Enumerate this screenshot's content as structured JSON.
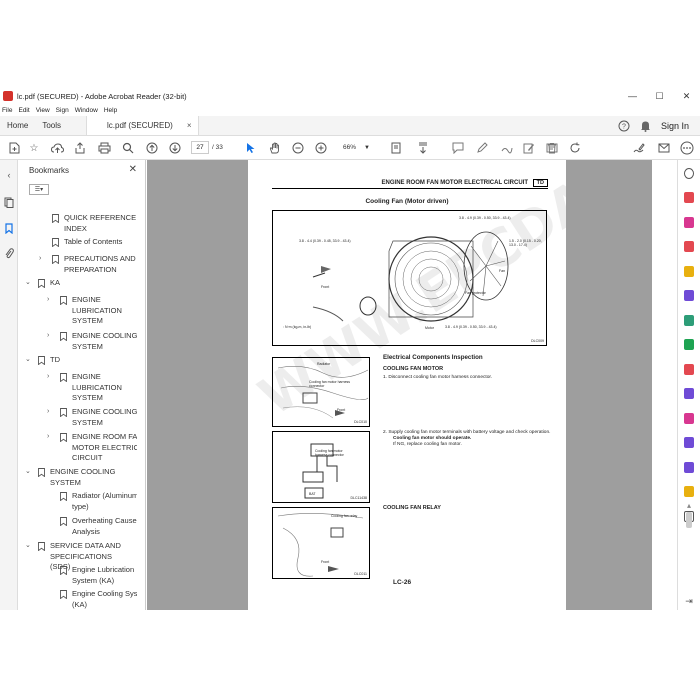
{
  "window": {
    "title": "lc.pdf (SECURED) - Adobe Acrobat Reader (32-bit)",
    "minimize": "—",
    "maximize": "☐",
    "close": "✕"
  },
  "menu": [
    "File",
    "Edit",
    "View",
    "Sign",
    "Window",
    "Help"
  ],
  "tabs": {
    "home": "Home",
    "tools": "Tools",
    "document": "lc.pdf (SECURED)",
    "close": "×",
    "signin": "Sign In"
  },
  "toolbar": {
    "page_current": "27",
    "page_total": "/ 33",
    "zoom": "66%"
  },
  "bookmarks": {
    "title": "Bookmarks",
    "close": "✕",
    "options": "☰▾",
    "items": [
      {
        "label": "QUICK REFERENCE INDEX",
        "chevron": ""
      },
      {
        "label": "Table of Contents",
        "chevron": ""
      },
      {
        "label": "PRECAUTIONS AND PREPARATION",
        "chevron": "›"
      },
      {
        "label": "KA",
        "chevron": "⌄"
      },
      {
        "label": "ENGINE LUBRICATION SYSTEM",
        "chevron": "›"
      },
      {
        "label": "ENGINE COOLING SYSTEM",
        "chevron": "›"
      },
      {
        "label": "TD",
        "chevron": "⌄"
      },
      {
        "label": "ENGINE LUBRICATION SYSTEM",
        "chevron": "›"
      },
      {
        "label": "ENGINE COOLING SYSTEM",
        "chevron": "›"
      },
      {
        "label": "ENGINE ROOM FAN MOTOR ELECTRICAL CIRCUIT",
        "chevron": "›"
      },
      {
        "label": "ENGINE COOLING SYSTEM",
        "chevron": "⌄"
      },
      {
        "label": "Radiator (Aluminum type)",
        "chevron": ""
      },
      {
        "label": "Overheating Cause Analysis",
        "chevron": ""
      },
      {
        "label": "SERVICE DATA AND SPECIFICATIONS (SDS)",
        "chevron": "⌄"
      },
      {
        "label": "Engine Lubrication System (KA)",
        "chevron": ""
      },
      {
        "label": "Engine Cooling System (KA)",
        "chevron": ""
      }
    ]
  },
  "document": {
    "header": "ENGINE ROOM FAN MOTOR ELECTRICAL CIRCUIT",
    "header_tag": "TD",
    "figure_title": "Cooling Fan (Motor driven)",
    "fig1_labels": {
      "torque_a": "3.8 - 4.4 (0.39 - 0.45, 33.9 - 43.4)",
      "torque_b": "3.8 - 4.9 (0.39 - 0.50, 33.9 - 43.4)",
      "torque_c": "1.5 - 2.0 (0.15 - 0.20, 13.0 - 17.4)",
      "torque_d": "3.8 - 4.9 (0.39 - 0.50, 33.9 - 43.4)",
      "fan": "Fan",
      "fan_protector": "Fan protector",
      "front": "Front",
      "motor": "Motor",
      "unit": ": N·m (kg-m, in-lb)",
      "code": "DLC009"
    },
    "section_title": "Electrical Components Inspection",
    "section_sub": "COOLING FAN MOTOR",
    "step1": "1.   Disconnect cooling fan motor harness connector.",
    "step2_a": "2.   Supply cooling fan motor terminals with battery voltage and check operation.",
    "step2_b": "Cooling fan motor should operate.",
    "step2_c": "If NG, replace cooling fan motor.",
    "relay_title": "COOLING FAN RELAY",
    "fig2_labels": {
      "radiator": "Radiator",
      "connector": "Cooling fan motor harness connector",
      "front": "Front",
      "code": "DLC010"
    },
    "fig3_labels": {
      "connector": "Cooling fan motor harness connector",
      "bat": "BAT",
      "code": "DLC11438"
    },
    "fig4_labels": {
      "relay": "Cooling fan relay",
      "front": "Front",
      "code": "DLC011"
    },
    "page_number": "LC-26",
    "watermark": "WWW.EPCDATA.COM"
  },
  "colors": {
    "accent": "#1473e6",
    "doc_background": "#9e9e9e",
    "title_icon": "#d4312a"
  }
}
